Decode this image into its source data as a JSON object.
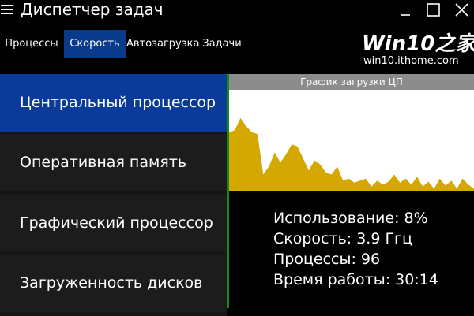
{
  "window": {
    "title": "Диспетчер задач",
    "icons": [
      "hamburger-menu-icon",
      "minimize-icon",
      "maximize-icon",
      "close-icon"
    ]
  },
  "tabs": [
    {
      "label": "Процессы",
      "active": false
    },
    {
      "label": "Скорость",
      "active": true
    },
    {
      "label": "Автозагрузка",
      "active": false
    },
    {
      "label": "Задачи",
      "active": false
    }
  ],
  "watermark": {
    "main": "Win10之家",
    "sub": "win10.ithome.com"
  },
  "sidebar": {
    "items": [
      {
        "label": "Центральный процессор",
        "active": true
      },
      {
        "label": "Оперативная память",
        "active": false
      },
      {
        "label": "Графический процессор",
        "active": false
      },
      {
        "label": "Загруженность дисков",
        "active": false
      }
    ]
  },
  "cpu_chart": {
    "title": "График загрузки ЦП",
    "fill_color": "#d4a800",
    "background_color": "#ffffff",
    "samples": [
      58,
      60,
      72,
      64,
      58,
      56,
      16,
      24,
      38,
      28,
      36,
      46,
      44,
      32,
      20,
      30,
      26,
      18,
      16,
      24,
      10,
      12,
      8,
      10,
      12,
      4,
      10,
      6,
      9,
      16,
      8,
      12,
      6,
      14,
      4,
      9,
      2,
      12,
      5,
      10,
      2,
      12,
      6,
      2
    ]
  },
  "stats": {
    "usage": "Использование: 8%",
    "speed": "Скорость: 3.9 Ггц",
    "processes": "Процессы: 96",
    "uptime": "Время работы: 30:14"
  },
  "colors": {
    "active_tab": "#0a3a8c",
    "active_nav": "#0a3a9a",
    "divider": "#138a13",
    "chart_header": "#8c8c8c"
  }
}
